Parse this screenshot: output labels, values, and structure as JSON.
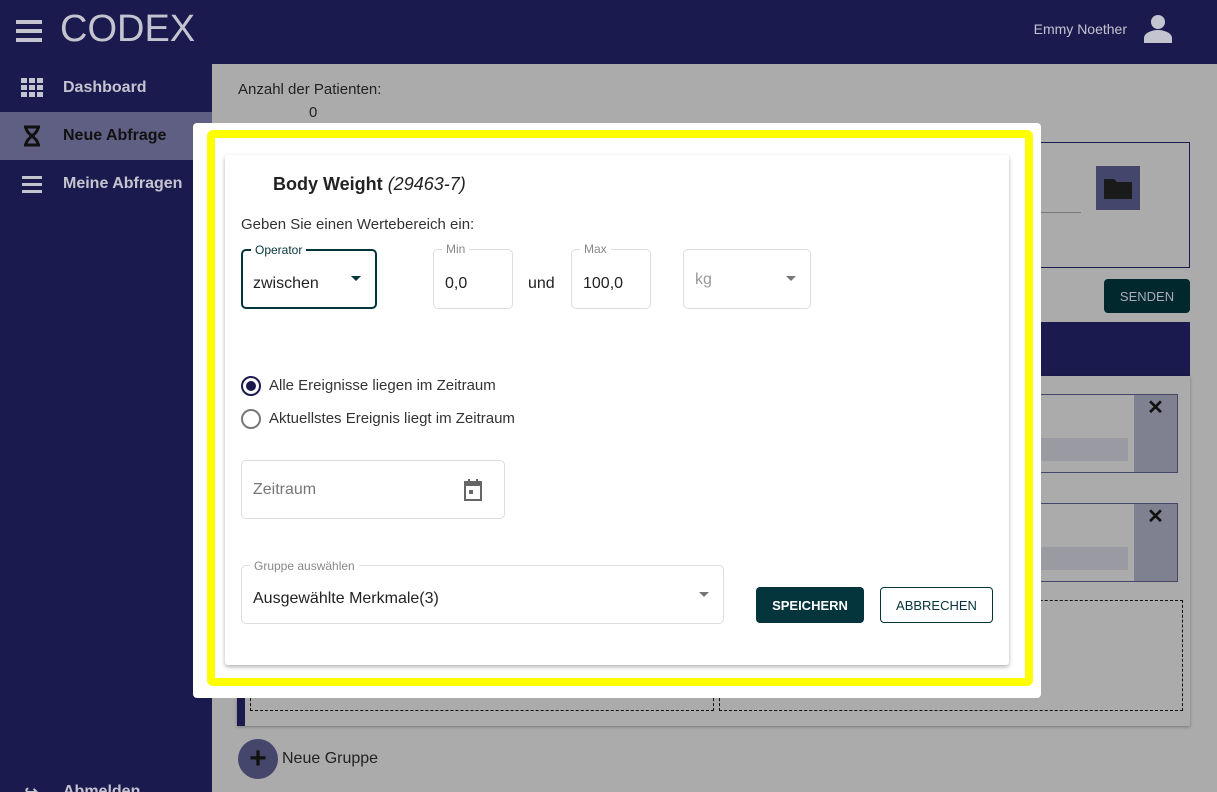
{
  "app": {
    "title": "CODEX",
    "user": "Emmy Noether"
  },
  "sidebar": {
    "items": [
      {
        "label": "Dashboard"
      },
      {
        "label": "Neue Abfrage"
      },
      {
        "label": "Meine Abfragen"
      }
    ],
    "logout": "Abmelden"
  },
  "main": {
    "patients_label": "Anzahl der Patienten:",
    "patients_count": "0",
    "send_button": "SENDEN",
    "new_group": "Neue Gruppe"
  },
  "dialog": {
    "title": "Body Weight",
    "code": "(29463-7)",
    "range_prompt": "Geben Sie einen Wertebereich ein:",
    "operator": {
      "label": "Operator",
      "value": "zwischen"
    },
    "min": {
      "label": "Min",
      "value": "0,0"
    },
    "and": "und",
    "max": {
      "label": "Max",
      "value": "100,0"
    },
    "unit": {
      "value": "kg"
    },
    "radios": [
      {
        "label": "Alle Ereignisse liegen im Zeitraum",
        "checked": true
      },
      {
        "label": "Aktuellstes Ereignis liegt im Zeitraum",
        "checked": false
      }
    ],
    "timeframe": {
      "placeholder": "Zeitraum"
    },
    "group": {
      "label": "Gruppe auswählen",
      "value": "Ausgewählte Merkmale(3)"
    },
    "save": "SPEICHERN",
    "cancel": "ABBRECHEN"
  },
  "colors": {
    "primary": "#1b1a4e",
    "accent": "#04343c",
    "highlight": "#ffff00"
  }
}
